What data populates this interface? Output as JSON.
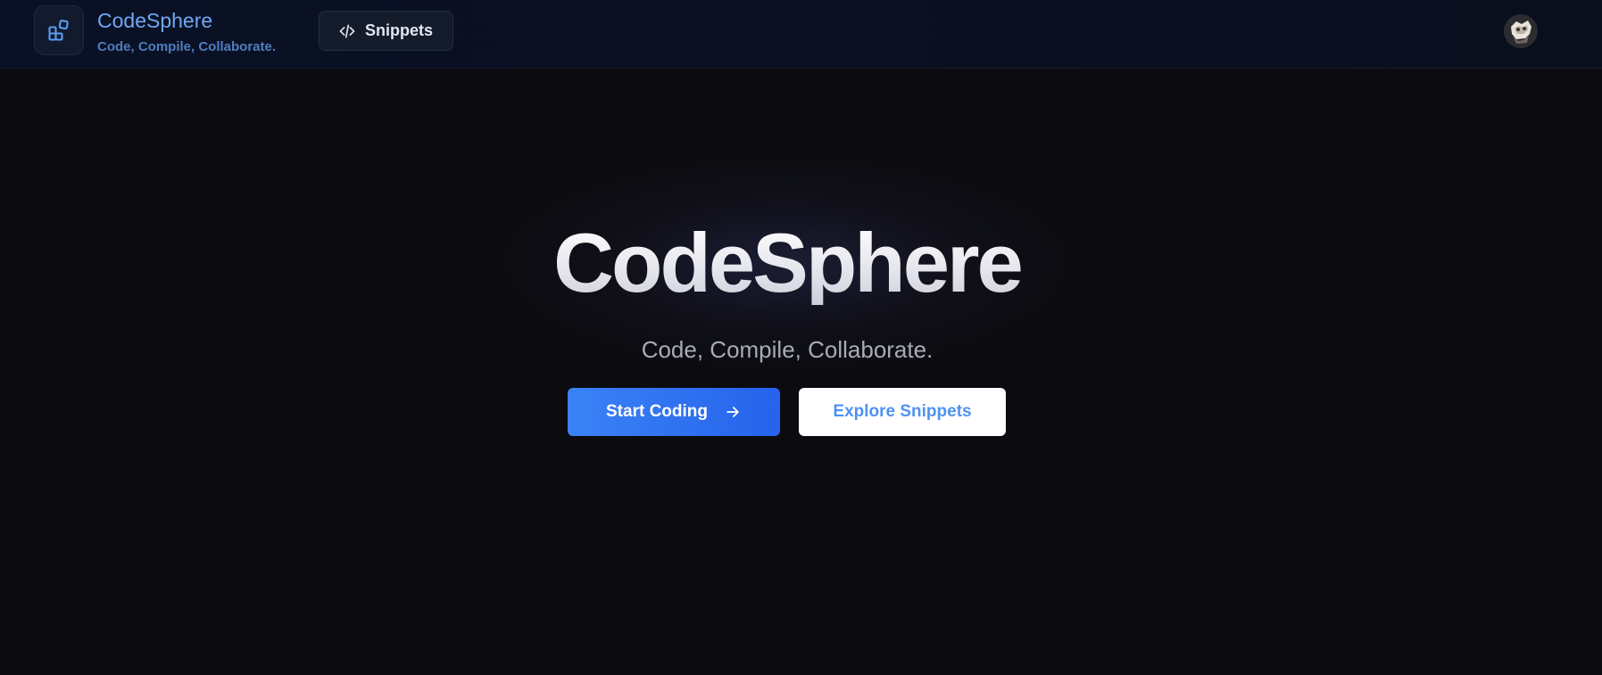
{
  "header": {
    "brand_title": "CodeSphere",
    "brand_subtitle": "Code, Compile, Collaborate.",
    "logo_icon": "layout-blocks-icon",
    "nav": {
      "snippets_label": "Snippets",
      "snippets_icon": "code-icon"
    },
    "avatar_icon": "user-avatar"
  },
  "hero": {
    "title": "CodeSphere",
    "subtitle": "Code, Compile, Collaborate.",
    "primary_button": {
      "label": "Start Coding",
      "icon": "arrow-right-icon"
    },
    "secondary_button": {
      "label": "Explore Snippets"
    }
  },
  "colors": {
    "background": "#0b0b10",
    "header_bg": "#0a1124",
    "accent_blue": "#3b82f6",
    "brand_text": "#6fa8f5",
    "secondary_button_text": "#4f92f0"
  }
}
